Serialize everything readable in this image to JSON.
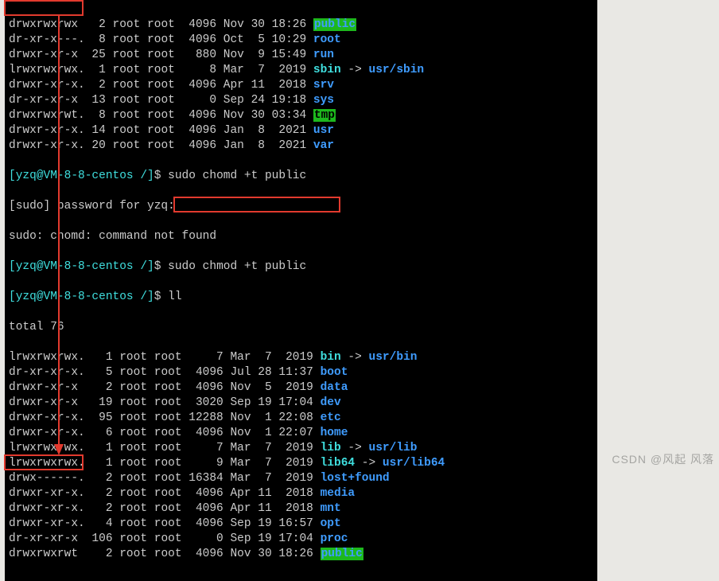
{
  "prompt": {
    "user": "yzq",
    "host": "VM-8-8-centos",
    "path": "/",
    "open": "[",
    "close": "]",
    "dollar": "$"
  },
  "commands": {
    "cmd1": "sudo chomd +t public",
    "cmd2": "sudo chmod +t public",
    "cmd3": "ll"
  },
  "text": {
    "sudo_pw": "[sudo] password for yzq:",
    "sudo_err": "sudo: chomd: command not found",
    "total": "total 76"
  },
  "arrow": " -> ",
  "listing1": [
    {
      "perm": "drwxrwxrwx ",
      "links": "  2",
      "owner": " root root",
      "size": "  4096",
      "date": " Nov 30 18:26 ",
      "name": "public",
      "cls": "fn-hl-green"
    },
    {
      "perm": "dr-xr-x---.",
      "links": "  8",
      "owner": " root root",
      "size": "  4096",
      "date": " Oct  5 10:29 ",
      "name": "root",
      "cls": "fn-dir"
    },
    {
      "perm": "drwxr-xr-x ",
      "links": " 25",
      "owner": " root root",
      "size": "   880",
      "date": " Nov  9 15:49 ",
      "name": "run",
      "cls": "fn-dir"
    },
    {
      "perm": "lrwxrwxrwx.",
      "links": "  1",
      "owner": " root root",
      "size": "     8",
      "date": " Mar  7  2019 ",
      "name": "sbin",
      "cls": "fn-link",
      "target": "usr/sbin"
    },
    {
      "perm": "drwxr-xr-x.",
      "links": "  2",
      "owner": " root root",
      "size": "  4096",
      "date": " Apr 11  2018 ",
      "name": "srv",
      "cls": "fn-dir"
    },
    {
      "perm": "dr-xr-xr-x ",
      "links": " 13",
      "owner": " root root",
      "size": "     0",
      "date": " Sep 24 19:18 ",
      "name": "sys",
      "cls": "fn-dir"
    },
    {
      "perm": "drwxrwxrwt.",
      "links": "  8",
      "owner": " root root",
      "size": "  4096",
      "date": " Nov 30 03:34 ",
      "name": "tmp",
      "cls": "fn-tmp"
    },
    {
      "perm": "drwxr-xr-x.",
      "links": " 14",
      "owner": " root root",
      "size": "  4096",
      "date": " Jan  8  2021 ",
      "name": "usr",
      "cls": "fn-dir"
    },
    {
      "perm": "drwxr-xr-x.",
      "links": " 20",
      "owner": " root root",
      "size": "  4096",
      "date": " Jan  8  2021 ",
      "name": "var",
      "cls": "fn-dir"
    }
  ],
  "listing2": [
    {
      "perm": "lrwxrwxrwx.",
      "links": "   1",
      "owner": " root root",
      "size": "     7",
      "date": " Mar  7  2019 ",
      "name": "bin",
      "cls": "fn-link",
      "target": "usr/bin"
    },
    {
      "perm": "dr-xr-xr-x.",
      "links": "   5",
      "owner": " root root",
      "size": "  4096",
      "date": " Jul 28 11:37 ",
      "name": "boot",
      "cls": "fn-dir"
    },
    {
      "perm": "drwxr-xr-x ",
      "links": "   2",
      "owner": " root root",
      "size": "  4096",
      "date": " Nov  5  2019 ",
      "name": "data",
      "cls": "fn-dir"
    },
    {
      "perm": "drwxr-xr-x ",
      "links": "  19",
      "owner": " root root",
      "size": "  3020",
      "date": " Sep 19 17:04 ",
      "name": "dev",
      "cls": "fn-dir"
    },
    {
      "perm": "drwxr-xr-x.",
      "links": "  95",
      "owner": " root root",
      "size": " 12288",
      "date": " Nov  1 22:08 ",
      "name": "etc",
      "cls": "fn-dir"
    },
    {
      "perm": "drwxr-xr-x.",
      "links": "   6",
      "owner": " root root",
      "size": "  4096",
      "date": " Nov  1 22:07 ",
      "name": "home",
      "cls": "fn-dir"
    },
    {
      "perm": "lrwxrwxrwx.",
      "links": "   1",
      "owner": " root root",
      "size": "     7",
      "date": " Mar  7  2019 ",
      "name": "lib",
      "cls": "fn-link",
      "target": "usr/lib"
    },
    {
      "perm": "lrwxrwxrwx.",
      "links": "   1",
      "owner": " root root",
      "size": "     9",
      "date": " Mar  7  2019 ",
      "name": "lib64",
      "cls": "fn-link",
      "target": "usr/lib64"
    },
    {
      "perm": "drwx------.",
      "links": "   2",
      "owner": " root root",
      "size": " 16384",
      "date": " Mar  7  2019 ",
      "name": "lost+found",
      "cls": "fn-dir"
    },
    {
      "perm": "drwxr-xr-x.",
      "links": "   2",
      "owner": " root root",
      "size": "  4096",
      "date": " Apr 11  2018 ",
      "name": "media",
      "cls": "fn-dir"
    },
    {
      "perm": "drwxr-xr-x.",
      "links": "   2",
      "owner": " root root",
      "size": "  4096",
      "date": " Apr 11  2018 ",
      "name": "mnt",
      "cls": "fn-dir"
    },
    {
      "perm": "drwxr-xr-x.",
      "links": "   4",
      "owner": " root root",
      "size": "  4096",
      "date": " Sep 19 16:57 ",
      "name": "opt",
      "cls": "fn-dir"
    },
    {
      "perm": "dr-xr-xr-x ",
      "links": " 106",
      "owner": " root root",
      "size": "     0",
      "date": " Sep 19 17:04 ",
      "name": "proc",
      "cls": "fn-dir"
    },
    {
      "perm": "drwxrwxrwt ",
      "links": "   2",
      "owner": " root root",
      "size": "  4096",
      "date": " Nov 30 18:26 ",
      "name": "public",
      "cls": "fn-hl-green"
    }
  ],
  "watermark": "CSDN @风起   风落"
}
